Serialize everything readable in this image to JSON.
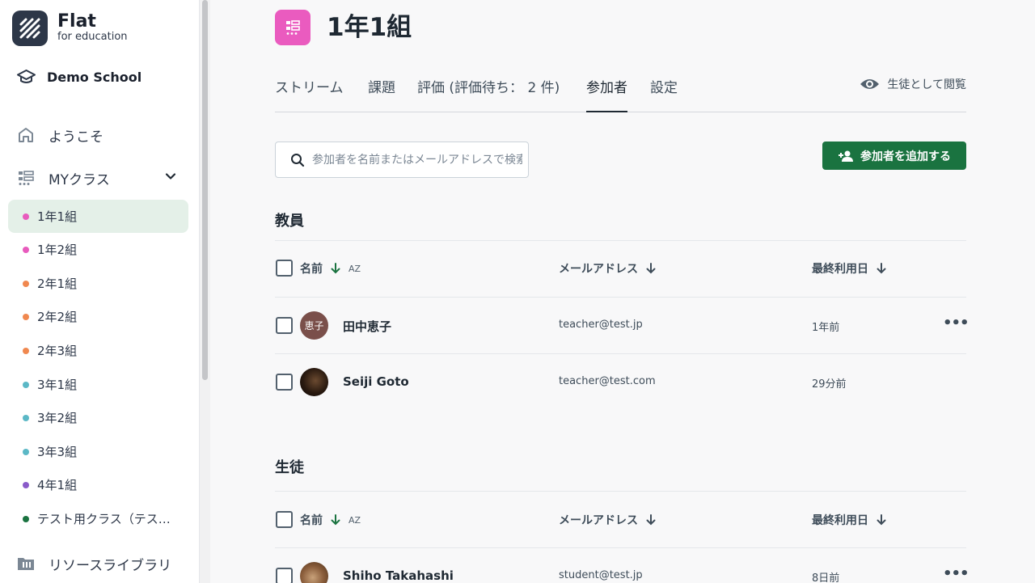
{
  "brand": {
    "title": "Flat",
    "subtitle": "for education"
  },
  "sidebar": {
    "school": "Demo School",
    "welcome": "ようこそ",
    "my_classes": "MYクラス",
    "classes": [
      {
        "label": "1年1組",
        "color": "#e85bbd",
        "active": true
      },
      {
        "label": "1年2組",
        "color": "#e85bbd"
      },
      {
        "label": "2年1組",
        "color": "#f0884f"
      },
      {
        "label": "2年2組",
        "color": "#f0884f"
      },
      {
        "label": "2年3組",
        "color": "#f0884f"
      },
      {
        "label": "3年1組",
        "color": "#5bb8c6"
      },
      {
        "label": "3年2組",
        "color": "#5bb8c6"
      },
      {
        "label": "3年3組",
        "color": "#5bb8c6"
      },
      {
        "label": "4年1組",
        "color": "#8a5bc9"
      },
      {
        "label": "テスト用クラス（テスト用）",
        "color": "#1a7340"
      }
    ],
    "resource_library": "リソースライブラリ"
  },
  "header": {
    "class_title": "1年1組"
  },
  "tabs": {
    "stream": "ストリーム",
    "assignments": "課題",
    "grades": "評価 (評価待ち： 2 件)",
    "members": "参加者",
    "settings": "設定",
    "view_as_student": "生徒として閲覧"
  },
  "search": {
    "placeholder": "参加者を名前またはメールアドレスで検索"
  },
  "add_button": "参加者を追加する",
  "columns": {
    "name": "名前",
    "email": "メールアドレス",
    "last_used": "最終利用日",
    "az": "AZ"
  },
  "teachers": {
    "title": "教員",
    "rows": [
      {
        "avatar_text": "恵子",
        "name": "田中恵子",
        "email": "teacher@test.jp",
        "last_used": "1年前"
      },
      {
        "name": "Seiji Goto",
        "email": "teacher@test.com",
        "last_used": "29分前"
      }
    ]
  },
  "students": {
    "title": "生徒",
    "rows": [
      {
        "name": "Shiho Takahashi",
        "email": "student@test.jp",
        "last_used": "8日前"
      }
    ]
  },
  "colors": {
    "accent": "#1a7340",
    "class_icon": "#ea5bbf"
  }
}
